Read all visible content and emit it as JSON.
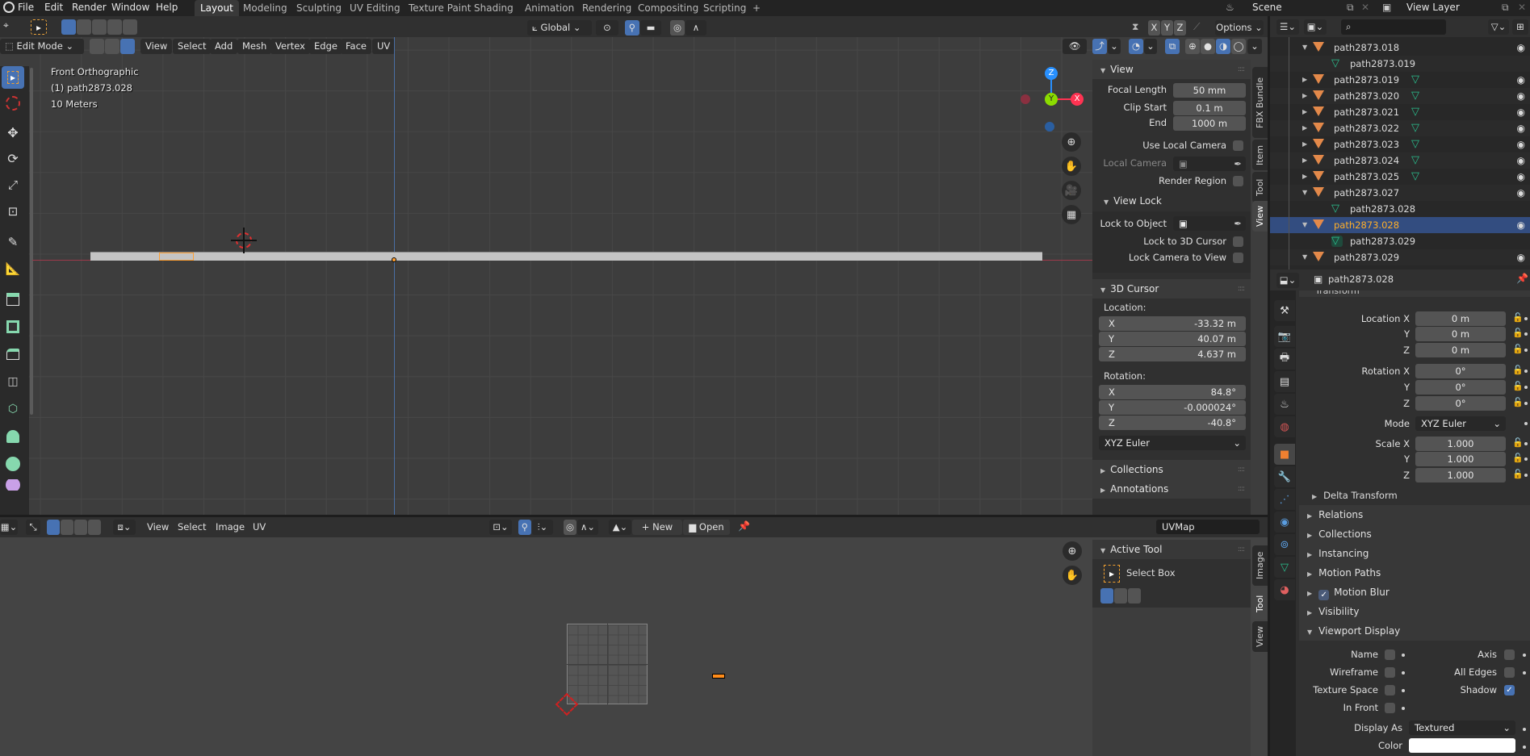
{
  "app_menu": {
    "items": [
      "File",
      "Edit",
      "Render",
      "Window",
      "Help"
    ]
  },
  "workspace_tabs": [
    {
      "label": "Layout",
      "active": true
    },
    {
      "label": "Modeling",
      "active": false
    },
    {
      "label": "Sculpting",
      "active": false
    },
    {
      "label": "UV Editing",
      "active": false
    },
    {
      "label": "Texture Paint",
      "active": false
    },
    {
      "label": "Shading",
      "active": false
    },
    {
      "label": "Animation",
      "active": false
    },
    {
      "label": "Rendering",
      "active": false
    },
    {
      "label": "Compositing",
      "active": false
    },
    {
      "label": "Scripting",
      "active": false
    }
  ],
  "add_workspace": "+",
  "scene": {
    "name": "Scene",
    "view_layer": "View Layer"
  },
  "viewport": {
    "mode": "Edit Mode",
    "transform_orientation": "Global",
    "options_label": "Options",
    "axis_toggles": [
      "X",
      "Y",
      "Z"
    ],
    "menus": [
      "View",
      "Select",
      "Add",
      "Mesh",
      "Vertex",
      "Edge",
      "Face",
      "UV"
    ],
    "overlay_info": [
      "Front Orthographic",
      "(1) path2873.028",
      "10 Meters"
    ],
    "gizmo_axes": {
      "z": "Z",
      "y": "Y",
      "x": "X"
    },
    "colors": {
      "x_axis": "#ff3352",
      "y_axis": "#8bdc00",
      "z_axis": "#2890ff",
      "selection": "#ffa032",
      "active_blue": "#4772b3"
    },
    "tools": [
      "select-box",
      "cursor",
      "move",
      "rotate",
      "scale",
      "transform",
      "annotate",
      "measure",
      "extrude-region",
      "inset-faces",
      "bevel",
      "loop-cut",
      "knife",
      "poly-build",
      "spin",
      "smooth"
    ]
  },
  "n_panel": {
    "tabs": [
      "FBX Bundle",
      "Item",
      "Tool",
      "View"
    ],
    "active_tab": "View",
    "view": {
      "title": "View",
      "focal_length_label": "Focal Length",
      "focal_length": "50 mm",
      "clip_start_label": "Clip Start",
      "clip_start": "0.1 m",
      "clip_end_label": "End",
      "clip_end": "1000 m",
      "use_local_camera": "Use Local Camera",
      "local_camera": "Local Camera",
      "render_region": "Render Region"
    },
    "view_lock": {
      "title": "View Lock",
      "lock_to_object": "Lock to Object",
      "lock_to_3d_cursor": "Lock to 3D Cursor",
      "lock_camera_to_view": "Lock Camera to View"
    },
    "cursor": {
      "title": "3D Cursor",
      "location_label": "Location:",
      "location": [
        {
          "axis": "X",
          "value": "-33.32 m"
        },
        {
          "axis": "Y",
          "value": "40.07 m"
        },
        {
          "axis": "Z",
          "value": "4.637 m"
        }
      ],
      "rotation_label": "Rotation:",
      "rotation": [
        {
          "axis": "X",
          "value": "84.8°"
        },
        {
          "axis": "Y",
          "value": "-0.000024°"
        },
        {
          "axis": "Z",
          "value": "-40.8°"
        }
      ],
      "rotation_mode": "XYZ Euler"
    },
    "collapsed": [
      "Collections",
      "Annotations"
    ]
  },
  "outliner": {
    "search_placeholder": "",
    "rows": [
      {
        "name": "path2873.018",
        "type": "object",
        "expanded": true,
        "has_mesh": false,
        "visible": true
      },
      {
        "name": "path2873.019",
        "type": "mesh",
        "child": true
      },
      {
        "name": "path2873.019",
        "type": "object",
        "expanded": false,
        "has_mesh": true,
        "visible": true
      },
      {
        "name": "path2873.020",
        "type": "object",
        "expanded": false,
        "has_mesh": true,
        "visible": true
      },
      {
        "name": "path2873.021",
        "type": "object",
        "expanded": false,
        "has_mesh": true,
        "visible": true
      },
      {
        "name": "path2873.022",
        "type": "object",
        "expanded": false,
        "has_mesh": true,
        "visible": true
      },
      {
        "name": "path2873.023",
        "type": "object",
        "expanded": false,
        "has_mesh": true,
        "visible": true
      },
      {
        "name": "path2873.024",
        "type": "object",
        "expanded": false,
        "has_mesh": true,
        "visible": true
      },
      {
        "name": "path2873.025",
        "type": "object",
        "expanded": false,
        "has_mesh": true,
        "visible": true
      },
      {
        "name": "path2873.027",
        "type": "object",
        "expanded": true,
        "has_mesh": false,
        "visible": true
      },
      {
        "name": "path2873.028",
        "type": "mesh",
        "child": true
      },
      {
        "name": "path2873.028",
        "type": "object",
        "expanded": true,
        "has_mesh": false,
        "visible": true,
        "selected": true
      },
      {
        "name": "path2873.029",
        "type": "mesh",
        "child": true,
        "active": true
      },
      {
        "name": "path2873.029",
        "type": "object",
        "expanded": true,
        "has_mesh": false,
        "visible": true
      }
    ]
  },
  "properties": {
    "object_name": "path2873.028",
    "section_title": "Transform",
    "location_label": "Location X",
    "location": [
      "0 m",
      "0 m",
      "0 m"
    ],
    "rotation_label": "Rotation X",
    "rotation": [
      "0°",
      "0°",
      "0°"
    ],
    "mode_label": "Mode",
    "mode": "XYZ Euler",
    "scale_label": "Scale X",
    "scale": [
      "1.000",
      "1.000",
      "1.000"
    ],
    "axis_labels": [
      "Y",
      "Z"
    ],
    "delta_transform": "Delta Transform",
    "sections": [
      "Relations",
      "Collections",
      "Instancing",
      "Motion Paths",
      "Motion Blur",
      "Visibility"
    ],
    "motion_blur_enabled": true,
    "viewport_display": {
      "title": "Viewport Display",
      "name_label": "Name",
      "name": false,
      "axis_label": "Axis",
      "axis": false,
      "wireframe_label": "Wireframe",
      "wireframe": false,
      "all_edges_label": "All Edges",
      "all_edges": false,
      "texture_space_label": "Texture Space",
      "texture_space": false,
      "shadow_label": "Shadow",
      "shadow": true,
      "in_front_label": "In Front",
      "in_front": false,
      "display_as_label": "Display As",
      "display_as": "Textured",
      "color_label": "Color",
      "color": "#ffffff"
    }
  },
  "uv_editor": {
    "menus": [
      "View",
      "Select",
      "Image",
      "UV"
    ],
    "new_label": "New",
    "open_label": "Open",
    "uv_map": "UVMap",
    "tabs": [
      "Image",
      "Tool",
      "View"
    ],
    "active_tab": "Tool",
    "active_tool_title": "Active Tool",
    "active_tool": "Select Box"
  }
}
